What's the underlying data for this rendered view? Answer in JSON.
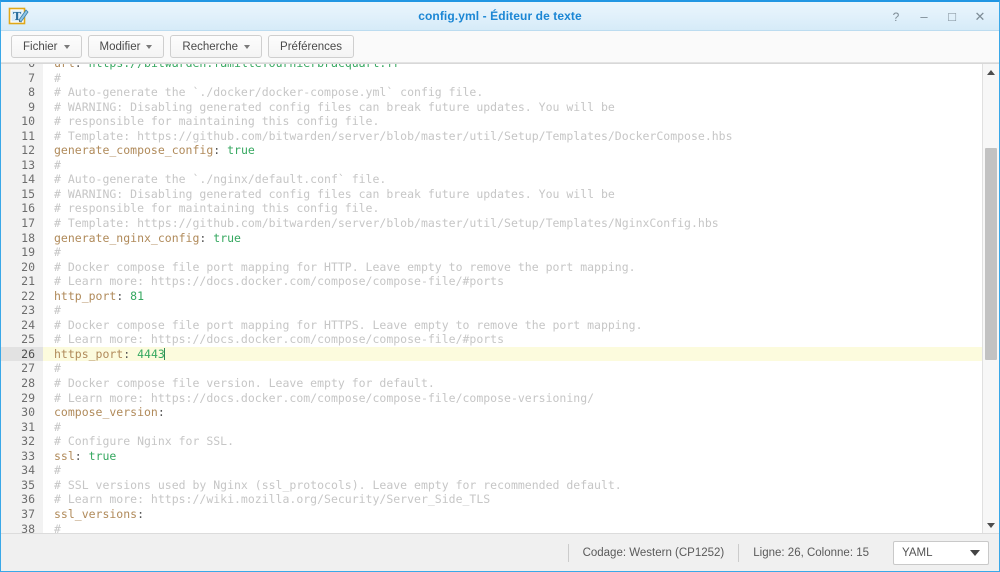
{
  "window": {
    "title": "config.yml - Éditeur de texte",
    "app_icon": "text-editor-icon",
    "controls": {
      "help": "?",
      "minimize": "–",
      "maximize": "□",
      "close": "✕"
    }
  },
  "toolbar": {
    "buttons": [
      {
        "label": "Fichier",
        "has_caret": true
      },
      {
        "label": "Modifier",
        "has_caret": true
      },
      {
        "label": "Recherche",
        "has_caret": true
      },
      {
        "label": "Préférences",
        "has_caret": false
      }
    ]
  },
  "editor": {
    "active_line": 26,
    "cursor_column": 15,
    "lines": [
      {
        "n": 6,
        "clipped": true,
        "tokens": [
          {
            "t": "key",
            "s": "url"
          },
          {
            "t": "punc",
            "s": ":"
          },
          {
            "t": "val",
            "s": " https://bitwarden.famillefournierbracquart.fr"
          }
        ]
      },
      {
        "n": 7,
        "tokens": [
          {
            "t": "cmt",
            "s": "#"
          }
        ]
      },
      {
        "n": 8,
        "tokens": [
          {
            "t": "cmt",
            "s": "# Auto-generate the `./docker/docker-compose.yml` config file."
          }
        ]
      },
      {
        "n": 9,
        "tokens": [
          {
            "t": "cmt",
            "s": "# WARNING: Disabling generated config files can break future updates. You will be"
          }
        ]
      },
      {
        "n": 10,
        "tokens": [
          {
            "t": "cmt",
            "s": "# responsible for maintaining this config file."
          }
        ]
      },
      {
        "n": 11,
        "tokens": [
          {
            "t": "cmt",
            "s": "# Template: https://github.com/bitwarden/server/blob/master/util/Setup/Templates/DockerCompose.hbs"
          }
        ]
      },
      {
        "n": 12,
        "tokens": [
          {
            "t": "key",
            "s": "generate_compose_config"
          },
          {
            "t": "punc",
            "s": ":"
          },
          {
            "t": "val",
            "s": " true"
          }
        ]
      },
      {
        "n": 13,
        "tokens": [
          {
            "t": "cmt",
            "s": "#"
          }
        ]
      },
      {
        "n": 14,
        "tokens": [
          {
            "t": "cmt",
            "s": "# Auto-generate the `./nginx/default.conf` file."
          }
        ]
      },
      {
        "n": 15,
        "tokens": [
          {
            "t": "cmt",
            "s": "# WARNING: Disabling generated config files can break future updates. You will be"
          }
        ]
      },
      {
        "n": 16,
        "tokens": [
          {
            "t": "cmt",
            "s": "# responsible for maintaining this config file."
          }
        ]
      },
      {
        "n": 17,
        "tokens": [
          {
            "t": "cmt",
            "s": "# Template: https://github.com/bitwarden/server/blob/master/util/Setup/Templates/NginxConfig.hbs"
          }
        ]
      },
      {
        "n": 18,
        "tokens": [
          {
            "t": "key",
            "s": "generate_nginx_config"
          },
          {
            "t": "punc",
            "s": ":"
          },
          {
            "t": "val",
            "s": " true"
          }
        ]
      },
      {
        "n": 19,
        "tokens": [
          {
            "t": "cmt",
            "s": "#"
          }
        ]
      },
      {
        "n": 20,
        "tokens": [
          {
            "t": "cmt",
            "s": "# Docker compose file port mapping for HTTP. Leave empty to remove the port mapping."
          }
        ]
      },
      {
        "n": 21,
        "tokens": [
          {
            "t": "cmt",
            "s": "# Learn more: https://docs.docker.com/compose/compose-file/#ports"
          }
        ]
      },
      {
        "n": 22,
        "tokens": [
          {
            "t": "key",
            "s": "http_port"
          },
          {
            "t": "punc",
            "s": ":"
          },
          {
            "t": "val",
            "s": " 81"
          }
        ]
      },
      {
        "n": 23,
        "tokens": [
          {
            "t": "cmt",
            "s": "#"
          }
        ]
      },
      {
        "n": 24,
        "tokens": [
          {
            "t": "cmt",
            "s": "# Docker compose file port mapping for HTTPS. Leave empty to remove the port mapping."
          }
        ]
      },
      {
        "n": 25,
        "tokens": [
          {
            "t": "cmt",
            "s": "# Learn more: https://docs.docker.com/compose/compose-file/#ports"
          }
        ]
      },
      {
        "n": 26,
        "active": true,
        "caret_after": true,
        "tokens": [
          {
            "t": "key",
            "s": "https_port"
          },
          {
            "t": "punc",
            "s": ":"
          },
          {
            "t": "val",
            "s": " 4443"
          }
        ]
      },
      {
        "n": 27,
        "tokens": [
          {
            "t": "cmt",
            "s": "#"
          }
        ]
      },
      {
        "n": 28,
        "tokens": [
          {
            "t": "cmt",
            "s": "# Docker compose file version. Leave empty for default."
          }
        ]
      },
      {
        "n": 29,
        "tokens": [
          {
            "t": "cmt",
            "s": "# Learn more: https://docs.docker.com/compose/compose-file/compose-versioning/"
          }
        ]
      },
      {
        "n": 30,
        "tokens": [
          {
            "t": "key",
            "s": "compose_version"
          },
          {
            "t": "punc",
            "s": ":"
          }
        ]
      },
      {
        "n": 31,
        "tokens": [
          {
            "t": "cmt",
            "s": "#"
          }
        ]
      },
      {
        "n": 32,
        "tokens": [
          {
            "t": "cmt",
            "s": "# Configure Nginx for SSL."
          }
        ]
      },
      {
        "n": 33,
        "tokens": [
          {
            "t": "key",
            "s": "ssl"
          },
          {
            "t": "punc",
            "s": ":"
          },
          {
            "t": "val",
            "s": " true"
          }
        ]
      },
      {
        "n": 34,
        "tokens": [
          {
            "t": "cmt",
            "s": "#"
          }
        ]
      },
      {
        "n": 35,
        "tokens": [
          {
            "t": "cmt",
            "s": "# SSL versions used by Nginx (ssl_protocols). Leave empty for recommended default."
          }
        ]
      },
      {
        "n": 36,
        "tokens": [
          {
            "t": "cmt",
            "s": "# Learn more: https://wiki.mozilla.org/Security/Server_Side_TLS"
          }
        ]
      },
      {
        "n": 37,
        "tokens": [
          {
            "t": "key",
            "s": "ssl_versions"
          },
          {
            "t": "punc",
            "s": ":"
          }
        ]
      },
      {
        "n": 38,
        "tokens": [
          {
            "t": "cmt",
            "s": "#"
          }
        ]
      }
    ]
  },
  "scrollbar": {
    "up_arrow": "chevron-up-icon",
    "down_arrow": "chevron-down-icon"
  },
  "statusbar": {
    "encoding": "Codage: Western (CP1252)",
    "position": "Ligne: 26, Colonne: 15",
    "language": "YAML"
  },
  "colors": {
    "accent": "#1b86d4",
    "titlebar_bg": "#e2f1fb",
    "active_line": "#fcfbdd",
    "comment": "#c6c6c6",
    "key": "#b08a5a",
    "value": "#36a860",
    "gutter_bg": "#f2f2f2"
  }
}
